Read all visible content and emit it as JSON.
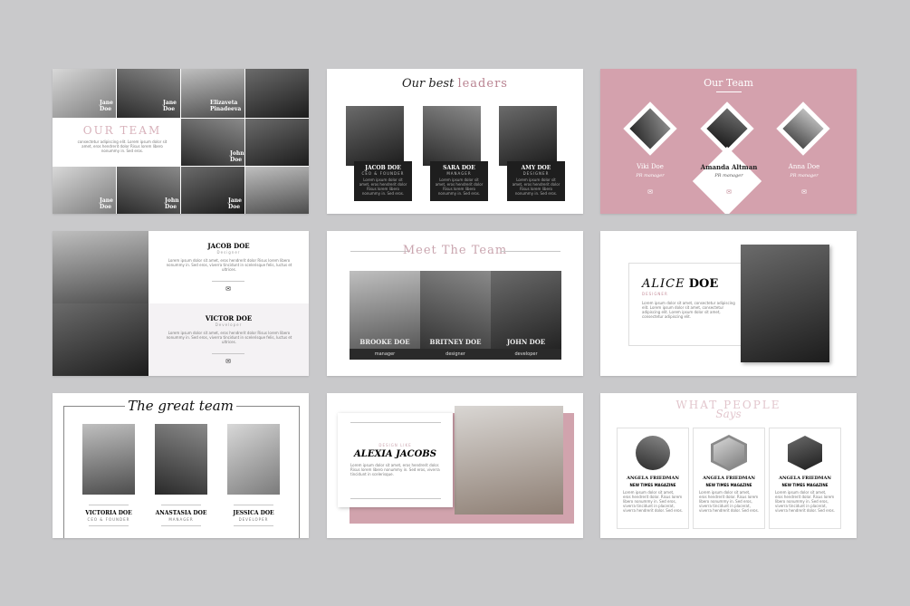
{
  "slide1": {
    "title": "OUR TEAM",
    "body": "consectetur adipiscing elit. Lorem ipsum dolor sit amet, eros hendrerit dolor Risus lorem libero nonummy in. Sed eros.",
    "names": [
      "Jane Doe",
      "Jane Doe",
      "Elizaveta Pinadeeva",
      "Jane Doe",
      "John Doe",
      "John Doe",
      "Jane Doe"
    ]
  },
  "slide2": {
    "title_a": "Our best",
    "title_b": "leaders",
    "cards": [
      {
        "name": "JACOB DOE",
        "role": "CEO & FOUNDER"
      },
      {
        "name": "SARA DOE",
        "role": "MANAGER"
      },
      {
        "name": "AMY DOE",
        "role": "DESIGNER"
      }
    ],
    "body": "Lorem ipsum dolor sit amet, eros hendrerit dolor Risus lorem libero nonummy in. Sed eros."
  },
  "slide3": {
    "title": "Our Team",
    "people": [
      {
        "name": "Viki Doe",
        "role": "PR manager"
      },
      {
        "name": "Amanda Altman",
        "role": "PR manager"
      },
      {
        "name": "Anna Doe",
        "role": "PR manager"
      }
    ],
    "icon": "twitter-icon",
    "accent": "#d4a1ad"
  },
  "slide4": {
    "people": [
      {
        "name": "JACOB DOE",
        "role": "Designer"
      },
      {
        "name": "VICTOR DOE",
        "role": "Developer"
      }
    ],
    "body": "Lorem ipsum dolor sit amet, eros hendrerit dolor Risus lorem libero nonummy in. Sed eros, viverra tincidunt in scelerisque felis, luctus et ultrices."
  },
  "slide5": {
    "title": "Meet The Team",
    "people": [
      {
        "name": "BROOKE DOE",
        "role": "manager"
      },
      {
        "name": "BRITNEY DOE",
        "role": "designer"
      },
      {
        "name": "JOHN DOE",
        "role": "developer"
      }
    ]
  },
  "slide6": {
    "first": "ALICE",
    "last": "DOE",
    "role": "DESIGNER",
    "body": "Lorem ipsum dolor sit amet, consectetur adipiscing elit. Lorem ipsum dolor sit amet, consectetur adipiscing elit. Lorem ipsum dolor sit amet, consectetur adipiscing elit."
  },
  "slide7": {
    "title": "The great team",
    "people": [
      {
        "name": "VICTORIA DOE",
        "role": "CEO & FOUNDER"
      },
      {
        "name": "ANASTASIA DOE",
        "role": "MANAGER"
      },
      {
        "name": "JESSICA DOE",
        "role": "DEVELOPER"
      }
    ]
  },
  "slide8": {
    "label": "DESIGN LIKE",
    "name": "ALEXIA JACOBS",
    "body": "Lorem ipsum dolor sit amet, eros hendrerit dolor. Risus lorem libero nonummy in. Sed eros, viverra tincidunt in scelerisque."
  },
  "slide9": {
    "title": "WHAT PEOPLE",
    "script": "Says",
    "cards": [
      {
        "name": "ANGELA FRIEDMAN",
        "mag": "NEW TIMES MAGAZINE"
      },
      {
        "name": "ANGELA FRIEDMAN",
        "mag": "NEW TIMES MAGAZINE"
      },
      {
        "name": "ANGELA FRIEDMAN",
        "mag": "NEW TIMES MAGAZINE"
      }
    ],
    "quote": "Lorem ipsum dolor sit amet, eros hendrerit dolor. Risus lorem libero nonummy in. Sed eros, viverra tincidunt in placerat, viverra hendrerit dolor. Sed eros."
  }
}
